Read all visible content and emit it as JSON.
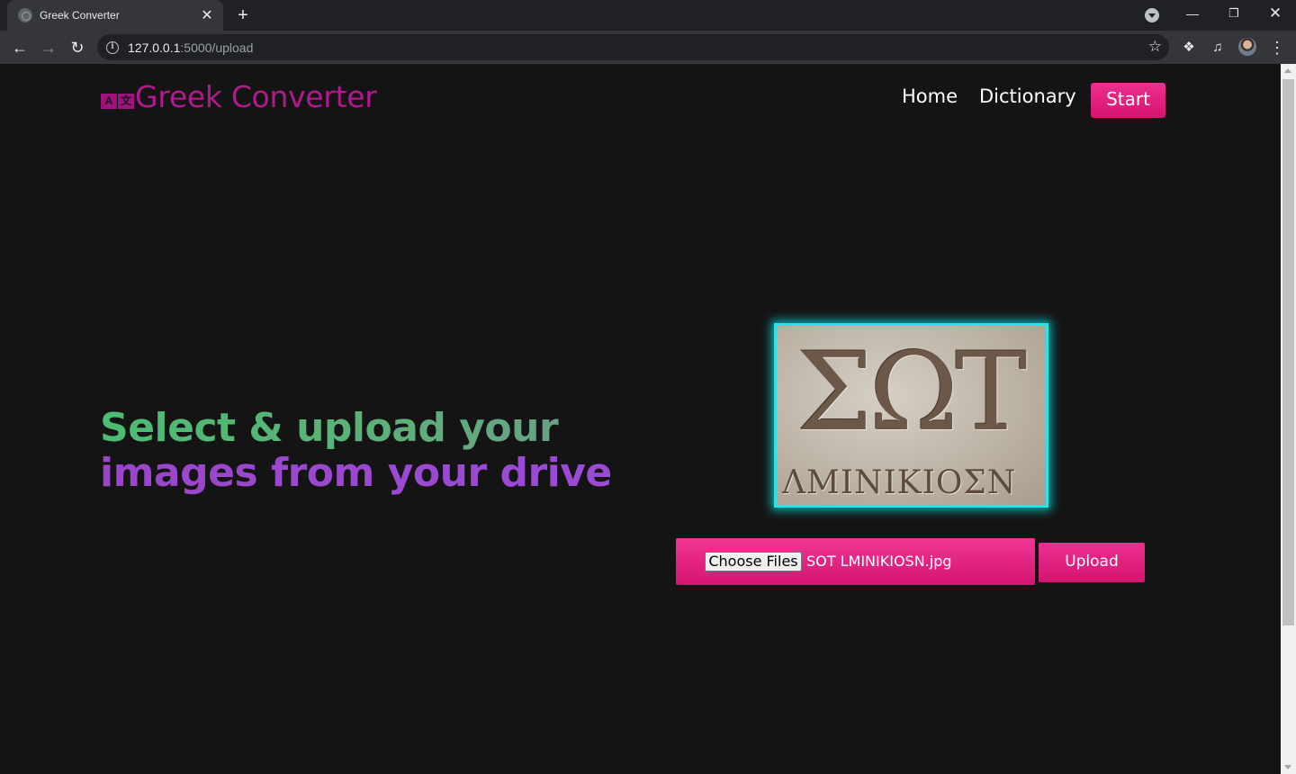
{
  "browser": {
    "tab_title": "Greek Converter",
    "url_host": "127.0.0.1",
    "url_path": ":5000/upload"
  },
  "site": {
    "logo_icon_left": "A",
    "logo_icon_right": "文",
    "brand": "Greek Converter",
    "nav": {
      "home": "Home",
      "dictionary": "Dictionary",
      "start": "Start"
    }
  },
  "hero": {
    "line1": "Select & upload your",
    "line2": "images from your drive"
  },
  "preview": {
    "big_letters": "ΣΩΤ",
    "small_letters": "ΛΜΙΝΙΚΙΟΣΝ"
  },
  "upload": {
    "choose_label": "Choose Files",
    "file_name": "SOT LMINIKIOSN.jpg",
    "upload_label": "Upload"
  },
  "colors": {
    "accent_pink": "#e11f7f",
    "brand_magenta": "#b01a8c",
    "headline_green": "#4bbd72",
    "headline_purple": "#9a46c9",
    "preview_glow": "#2de2e2",
    "page_bg": "#151415"
  },
  "icons": {
    "tab_favicon": "globe-icon",
    "new_tab": "plus-icon",
    "back": "arrow-left-icon",
    "forward": "arrow-right-icon",
    "reload": "reload-icon",
    "site_info": "info-icon",
    "bookmark": "star-icon",
    "extensions": "puzzle-icon",
    "media": "media-queue-icon",
    "menu": "kebab-menu-icon"
  }
}
